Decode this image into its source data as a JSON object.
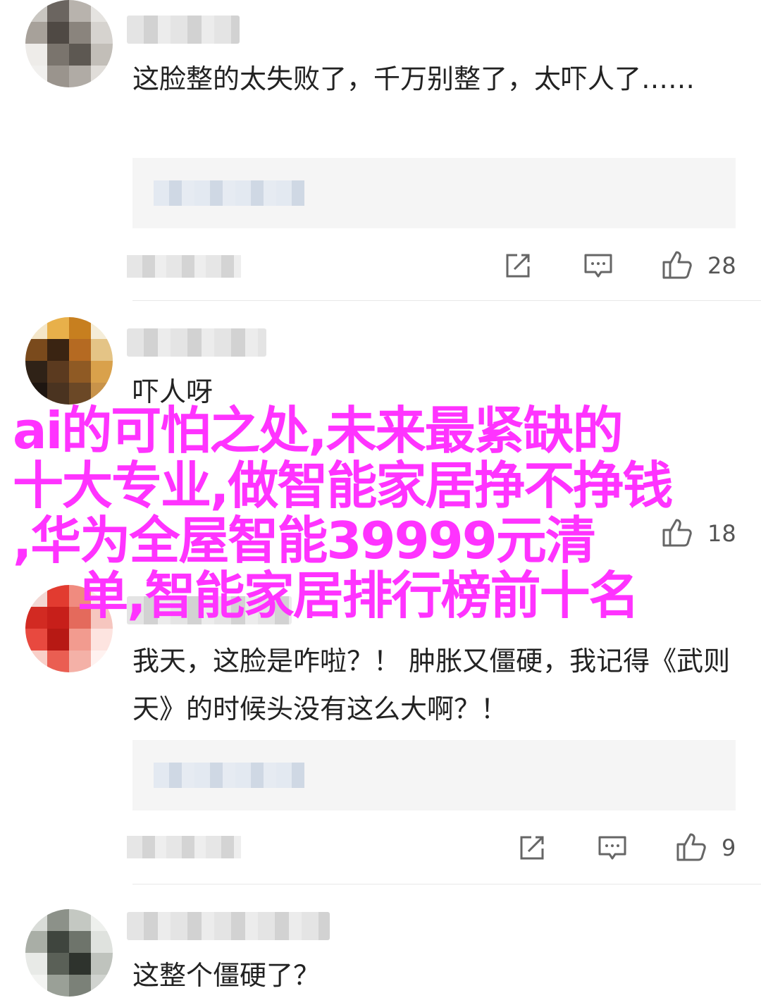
{
  "comments": [
    {
      "text": "这脸整的太失败了，千万别整了，太吓人了……",
      "likes": "28",
      "avatar_colors": [
        "#c9c6c1",
        "#6b6560",
        "#b8b3ad",
        "#e5e3e0",
        "#a7a19a",
        "#4f4944",
        "#8a847d",
        "#d6d3cf",
        "#eeece9",
        "#7a746d",
        "#5d5852",
        "#c2beb8",
        "#f1f0ee",
        "#9a948d",
        "#b0aba5",
        "#e0ddd9"
      ]
    },
    {
      "text": "吓人呀",
      "likes": "18",
      "avatar_colors": [
        "#f4e6c8",
        "#e8b04a",
        "#c77f1f",
        "#f5edd8",
        "#7a4a1c",
        "#3a2412",
        "#b56a22",
        "#e4c486",
        "#2f2217",
        "#5b3a1f",
        "#8f5a24",
        "#d9a14b",
        "#1e1611",
        "#4a3320",
        "#6b4826",
        "#c8934a"
      ]
    },
    {
      "text": "我天，这脸是咋啦？！ 肿胀又僵硬，我记得《武则天》的时候头没有这么大啊？！",
      "likes": "9",
      "avatar_colors": [
        "#f3d7d3",
        "#e23b30",
        "#f08b7f",
        "#fbeae7",
        "#d22a22",
        "#c71f1a",
        "#e46a5c",
        "#f6c6bf",
        "#e8493f",
        "#b71914",
        "#f29b8f",
        "#fde4e0",
        "#f9cfc8",
        "#ea5e52",
        "#f4b1a7",
        "#fff2f0"
      ]
    },
    {
      "text": "这整个僵硬了？",
      "likes": "",
      "avatar_colors": [
        "#d9dcd8",
        "#8c9189",
        "#c4c8c2",
        "#eef0ed",
        "#a9aea6",
        "#3f453e",
        "#6e746b",
        "#dfe2de",
        "#e8eae7",
        "#5a6057",
        "#2e332d",
        "#bfc3bd",
        "#f3f4f2",
        "#9aa097",
        "#7b8178",
        "#d0d3cf"
      ]
    }
  ],
  "overlay": {
    "lines": [
      "ai的可怕之处,未来最紧缺的",
      "十大专业,做智能家居挣不挣钱",
      ",华为全屋智能39999元清",
      "    单,智能家居排行榜前十名"
    ],
    "color": "#ff33ff"
  },
  "icons": [
    "share-icon",
    "comment-icon",
    "like-icon"
  ]
}
